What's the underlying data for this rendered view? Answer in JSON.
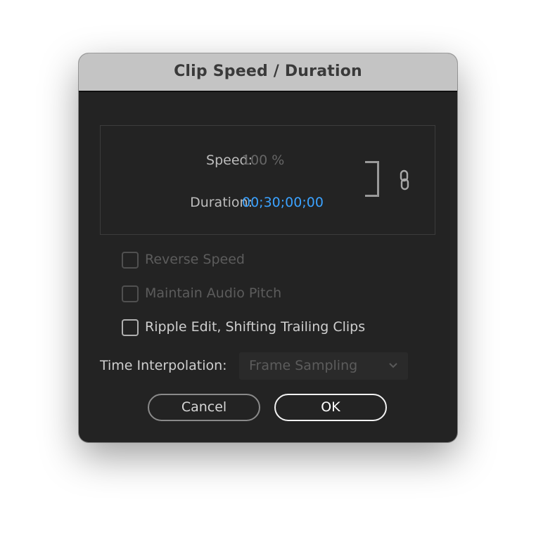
{
  "dialog": {
    "title": "Clip Speed / Duration",
    "speed_label": "Speed:",
    "speed_value": "100 %",
    "duration_label": "Duration:",
    "duration_value": "00;30;00;00",
    "checkboxes": [
      {
        "label": "Reverse Speed",
        "checked": false,
        "enabled": false
      },
      {
        "label": "Maintain Audio Pitch",
        "checked": false,
        "enabled": false
      },
      {
        "label": "Ripple Edit, Shifting Trailing Clips",
        "checked": false,
        "enabled": true
      }
    ],
    "time_interpolation_label": "Time Interpolation:",
    "time_interpolation_value": "Frame Sampling",
    "cancel_label": "Cancel",
    "ok_label": "OK"
  },
  "colors": {
    "dialog_bg": "#232323",
    "titlebar_bg": "#c4c4c4",
    "duration_accent": "#3ba2ff"
  },
  "icons": {
    "link": "link-icon",
    "dropdown": "chevron-down-icon"
  }
}
